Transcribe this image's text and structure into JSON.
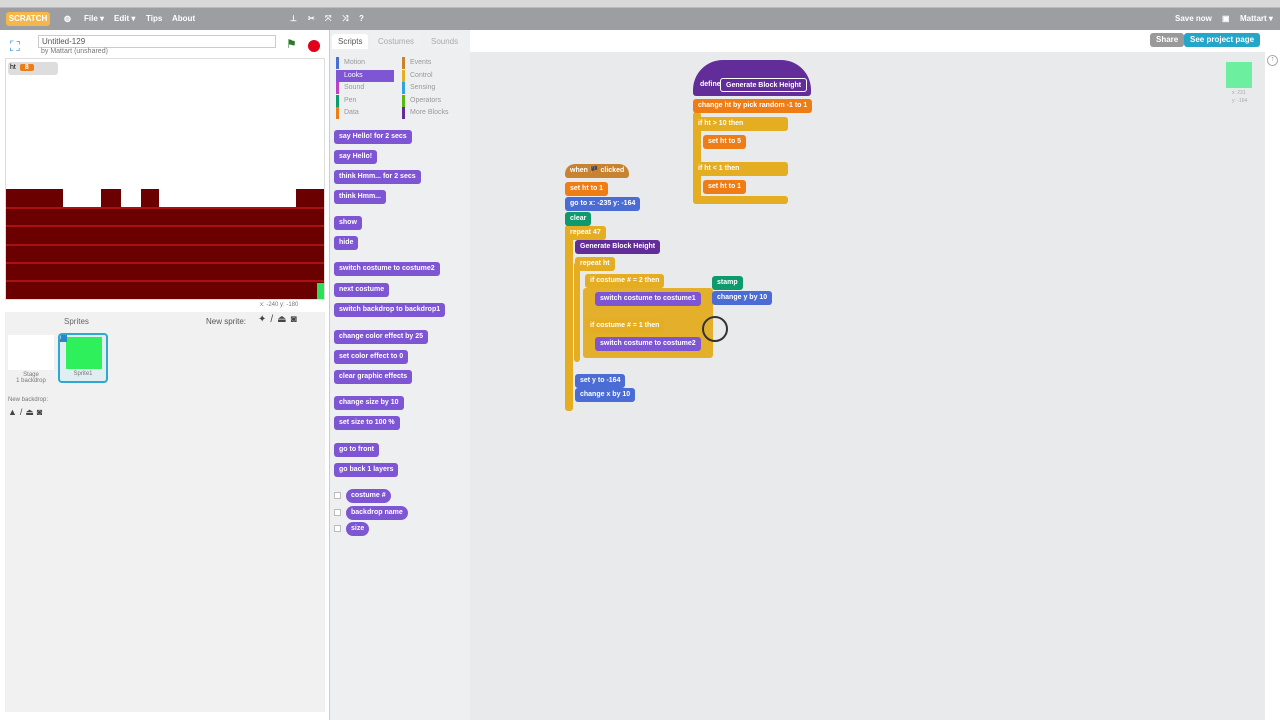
{
  "menu": {
    "logo": "SCRATCH",
    "file": "File ▾",
    "edit": "Edit ▾",
    "tips": "Tips",
    "about": "About",
    "save_now": "Save now",
    "user": "Mattart ▾"
  },
  "project": {
    "title": "Untitled-129",
    "by": "by Mattart (unshared)"
  },
  "stage": {
    "variable_name": "ht",
    "variable_value": "8",
    "coords": "x: -240  y: -180"
  },
  "sprites": {
    "header": "Sprites",
    "new_sprite": "New sprite:",
    "stage_label": "Stage",
    "stage_sub": "1 backdrop",
    "sprite_name": "Sprite1",
    "new_backdrop": "New backdrop:"
  },
  "tabs": [
    "Scripts",
    "Costumes",
    "Sounds"
  ],
  "categories": [
    {
      "label": "Motion",
      "color": "#4a6cd4"
    },
    {
      "label": "Events",
      "color": "#c88330"
    },
    {
      "label": "Looks",
      "color": "#7e55d3"
    },
    {
      "label": "Control",
      "color": "#e4ad22"
    },
    {
      "label": "Sound",
      "color": "#bb42c3"
    },
    {
      "label": "Sensing",
      "color": "#2ca5e2"
    },
    {
      "label": "Pen",
      "color": "#0e9a6c"
    },
    {
      "label": "Operators",
      "color": "#5cb712"
    },
    {
      "label": "Data",
      "color": "#ee7d16"
    },
    {
      "label": "More Blocks",
      "color": "#632d99"
    }
  ],
  "palette_blocks": [
    "say Hello! for 2 secs",
    "say Hello!",
    "think Hmm... for 2 secs",
    "think Hmm...",
    "show",
    "hide",
    "switch costume to costume2",
    "next costume",
    "switch backdrop to backdrop1",
    "change color effect by 25",
    "set color effect to 0",
    "clear graphic effects",
    "change size by 10",
    "set size to 100 %",
    "go to front",
    "go back 1 layers",
    "costume #",
    "backdrop name",
    "size"
  ],
  "header_buttons": {
    "share": "Share",
    "see_project": "See project page"
  },
  "sprite_info": {
    "x": "x: 231",
    "y": "y: -164"
  },
  "scripts": {
    "define": [
      "define",
      "Generate Block Height"
    ],
    "def_blocks": [
      "change ht by pick random -1 to 1",
      "if ht > 10 then",
      "set ht to 5",
      "if ht < 1 then",
      "set ht to 1"
    ],
    "main": [
      "when 🏴 clicked",
      "set ht to 1",
      "go to x: -235 y: -164",
      "clear",
      "repeat 47",
      "Generate Block Height",
      "repeat ht",
      "if costume # = 2 then",
      "switch costume to costume1",
      "if costume # = 1 then",
      "switch costume to costume2",
      "set y to -164",
      "change x by 10"
    ],
    "loose": [
      "stamp",
      "change y by 10"
    ]
  }
}
